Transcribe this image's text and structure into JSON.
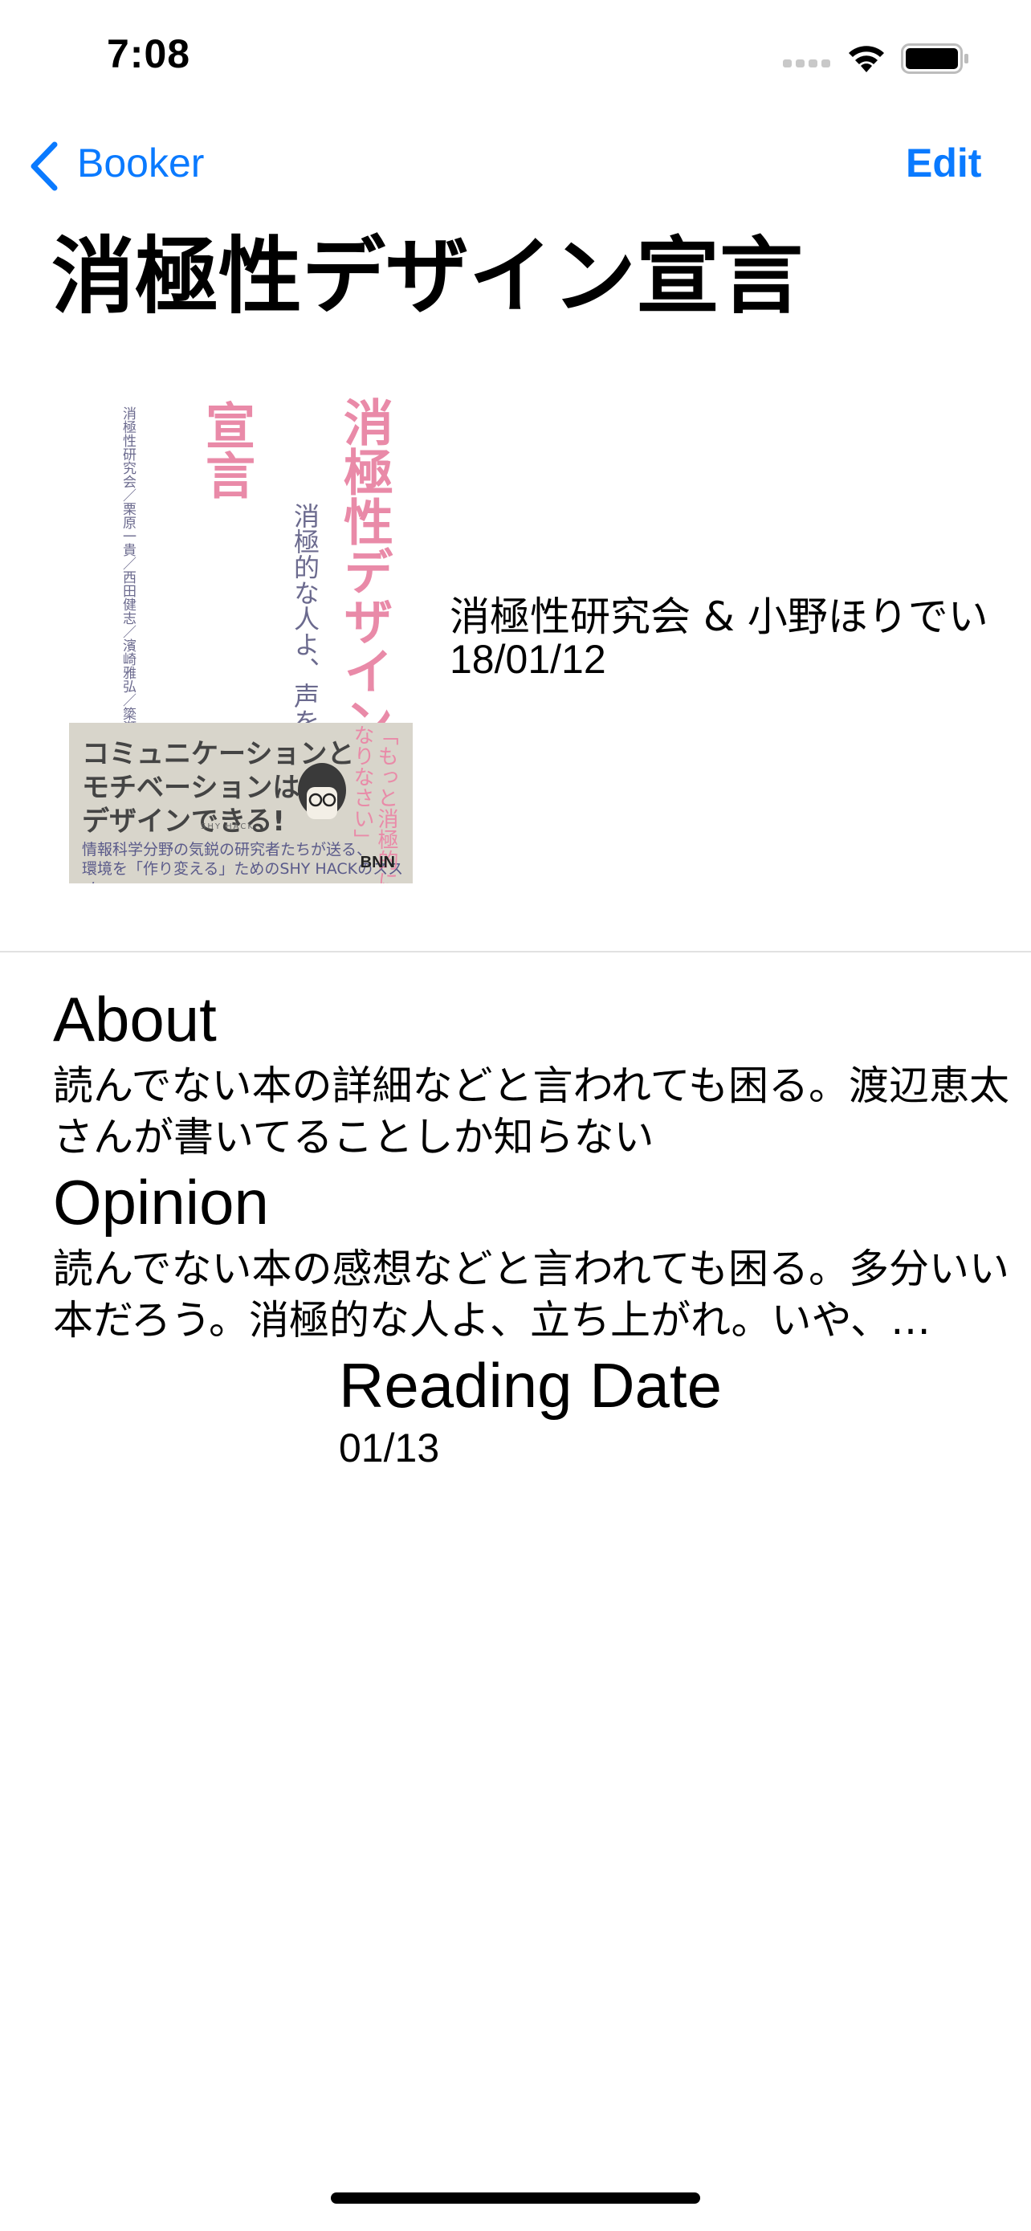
{
  "status_bar": {
    "time": "7:08"
  },
  "nav": {
    "back_label": "Booker",
    "edit_label": "Edit",
    "accent_color": "#0a7aff"
  },
  "book": {
    "title": "消極性デザイン宣言",
    "author": "消極性研究会 & 小野ほりでい",
    "published": "18/01/12",
    "cover": {
      "title_main": "消極性デザイン",
      "title_sub": "宣言",
      "tagline": "消極的な人よ、声を上げよ。……いや、上げなくてよい。",
      "authors": "消極性研究会／栗原一貴／西田健志／濱崎雅弘／簗瀬洋平／渡邊恵太 著",
      "band_text": "コミュニケーションと\nモチベーションは\nデザインできる!",
      "band_tag": "SHY HACK",
      "band_desc": "情報科学分野の気鋭の研究者たちが送る、\n環境を「作り変える」ためのSHY HACKのススメ。",
      "band_vertical": "「もっと消極的に\nなりなさい」",
      "logo": "BNN"
    }
  },
  "sections": {
    "about": {
      "heading": "About",
      "body": "読んでない本の詳細などと言われても困る。渡辺恵太さんが書いてることしか知らない"
    },
    "opinion": {
      "heading": "Opinion",
      "body": "読んでない本の感想などと言われても困る。多分いい本だろう。消極的な人よ、立ち上がれ。いや、…"
    },
    "reading_date": {
      "heading": "Reading Date",
      "value": "01/13"
    }
  }
}
